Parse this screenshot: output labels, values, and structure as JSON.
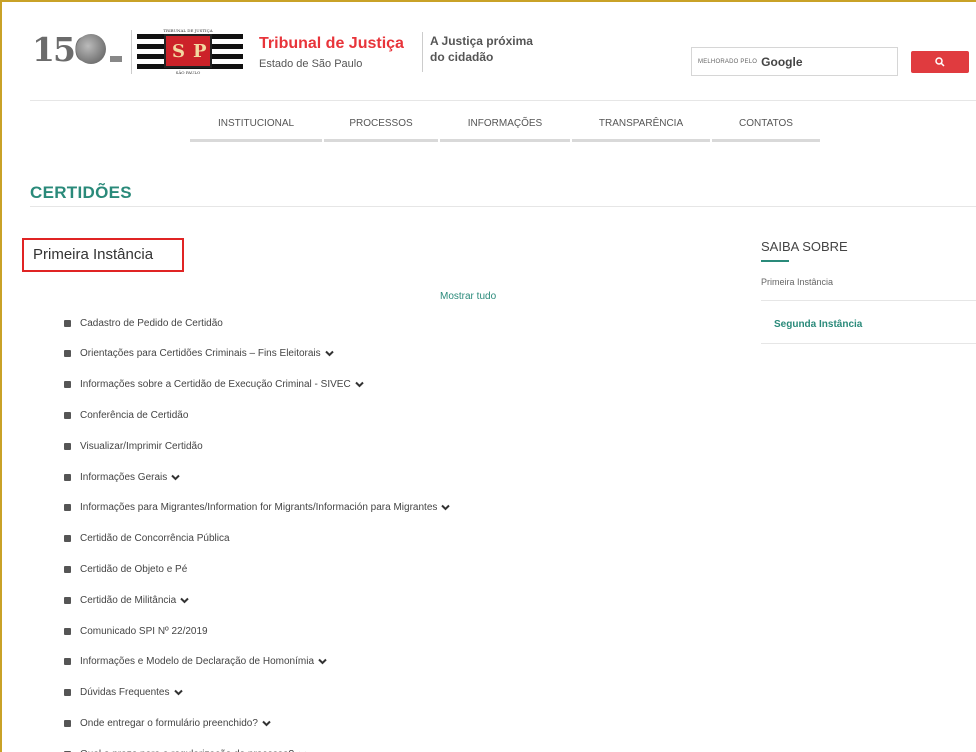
{
  "header": {
    "logo_number": "150",
    "flag_top_text": "TRIBUNAL DE JUSTIÇA",
    "flag_letters": [
      "S",
      "P"
    ],
    "flag_bottom_text": "SÃO PAULO",
    "court_name": "Tribunal de Justiça",
    "court_state": "Estado de São Paulo",
    "slogan_line1": "A Justiça próxima",
    "slogan_line2": "do cidadão",
    "search_prefix": "MELHORADO PELO",
    "search_brand": "Google"
  },
  "nav": {
    "items": [
      "INSTITUCIONAL",
      "PROCESSOS",
      "INFORMAÇÕES",
      "TRANSPARÊNCIA",
      "CONTATOS"
    ]
  },
  "page_title": "CERTIDÕES",
  "section": {
    "title": "Primeira Instância",
    "show_all": "Mostrar tudo",
    "items": [
      {
        "label": "Cadastro de Pedido de Certidão",
        "expandable": false
      },
      {
        "label": "Orientações para Certidões Criminais – Fins Eleitorais",
        "expandable": true
      },
      {
        "label": "Informações sobre a Certidão de Execução Criminal - SIVEC",
        "expandable": true
      },
      {
        "label": "Conferência de Certidão",
        "expandable": false
      },
      {
        "label": "Visualizar/Imprimir Certidão",
        "expandable": false
      },
      {
        "label": "Informações Gerais",
        "expandable": true
      },
      {
        "label": "Informações para Migrantes/Information for Migrants/Información para Migrantes",
        "expandable": true
      },
      {
        "label": "Certidão de Concorrência Pública",
        "expandable": false
      },
      {
        "label": "Certidão de Objeto e Pé",
        "expandable": false
      },
      {
        "label": "Certidão de Militância",
        "expandable": true
      },
      {
        "label": "Comunicado SPI Nº 22/2019",
        "expandable": false
      },
      {
        "label": "Informações e Modelo de Declaração de Homonímia",
        "expandable": true
      },
      {
        "label": "Dúvidas Frequentes",
        "expandable": true
      },
      {
        "label": "Onde entregar o formulário preenchido?",
        "expandable": true
      },
      {
        "label": "Qual o prazo para a regularização do processo?",
        "expandable": true
      }
    ]
  },
  "sidebar": {
    "title": "SAIBA SOBRE",
    "items": [
      "Primeira Instância",
      "Segunda Instância"
    ]
  },
  "colors": {
    "accent": "#2a8a7a",
    "brand_red": "#e8343a",
    "search_button": "#e03b3f",
    "highlight_box": "#e02424",
    "frame_border": "#c9a227"
  }
}
